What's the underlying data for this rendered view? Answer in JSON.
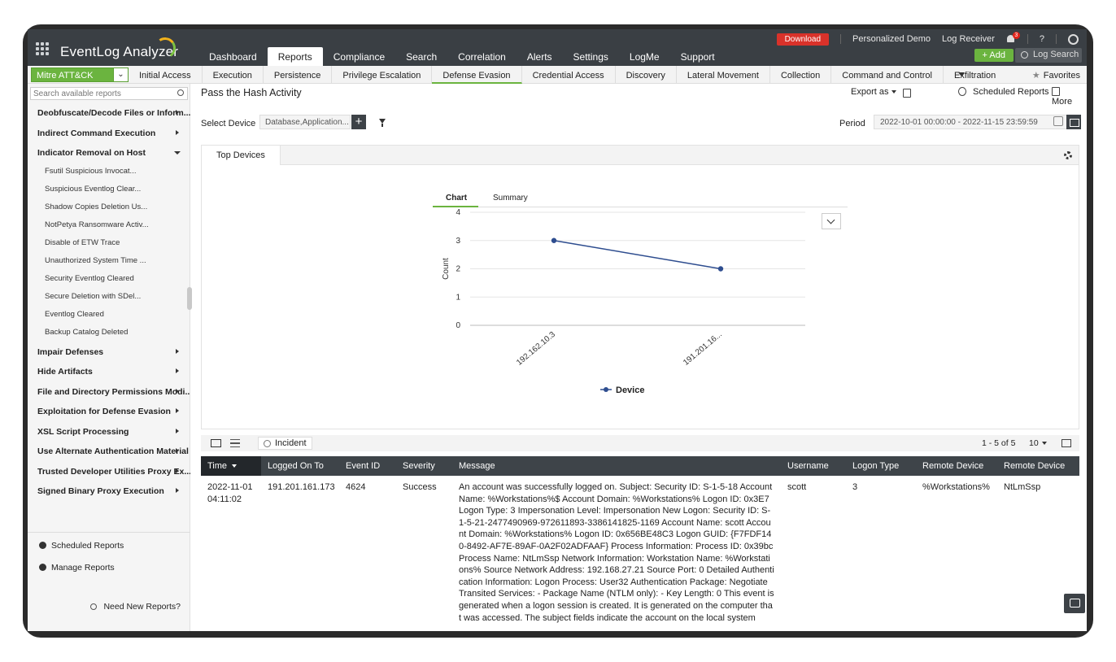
{
  "app": {
    "name": "EventLog Analyzer"
  },
  "main_nav": [
    "Dashboard",
    "Reports",
    "Compliance",
    "Search",
    "Correlation",
    "Alerts",
    "Settings",
    "LogMe",
    "Support"
  ],
  "main_nav_active": "Reports",
  "top_right": {
    "download": "Download",
    "personalized_demo": "Personalized Demo",
    "log_receiver": "Log Receiver",
    "notification_count": "3",
    "help": "?",
    "add": "+ Add",
    "log_search": "Log Search"
  },
  "sub_nav": {
    "framework": "Mitre ATT&CK",
    "tabs": [
      "Initial Access",
      "Execution",
      "Persistence",
      "Privilege Escalation",
      "Defense Evasion",
      "Credential Access",
      "Discovery",
      "Lateral Movement",
      "Collection",
      "Command and Control",
      "Exfiltration"
    ],
    "active": "Defense Evasion",
    "favorites": "Favorites"
  },
  "sidebar": {
    "search_placeholder": "Search available reports",
    "items_top": [
      {
        "label": "Deobfuscate/Decode Files or Inform...",
        "expanded": false
      },
      {
        "label": "Indirect Command Execution",
        "expanded": false
      },
      {
        "label": "Indicator Removal on Host",
        "expanded": true
      }
    ],
    "sub_items": [
      "Fsutil Suspicious Invocat...",
      "Suspicious Eventlog Clear...",
      "Shadow Copies Deletion Us...",
      "NotPetya Ransomware Activ...",
      "Disable of ETW Trace",
      "Unauthorized System Time ...",
      "Security Eventlog Cleared",
      "Secure Deletion with SDel...",
      "Eventlog Cleared",
      "Backup Catalog Deleted"
    ],
    "items_bottom": [
      "Impair Defenses",
      "Hide Artifacts",
      "File and Directory Permissions Modi...",
      "Exploitation for Defense Evasion",
      "XSL Script Processing",
      "Use Alternate Authentication Material",
      "Trusted Developer Utilities Proxy Ex...",
      "Signed Binary Proxy Execution"
    ],
    "scheduled_reports": "Scheduled Reports",
    "manage_reports": "Manage Reports",
    "need_new_reports": "Need New Reports?"
  },
  "report": {
    "title": "Pass the Hash Activity",
    "export_as": "Export as",
    "scheduled_reports": "Scheduled Reports",
    "more": "More",
    "select_device_label": "Select Device",
    "select_device_value": "Database,Application...",
    "period_label": "Period",
    "period_value": "2022-10-01 00:00:00 - 2022-11-15 23:59:59",
    "panel_tab": "Top Devices",
    "chart_tabs": [
      "Chart",
      "Summary"
    ]
  },
  "chart_data": {
    "type": "line",
    "categories": [
      "192.162.10.3",
      "191.201.16..."
    ],
    "series": [
      {
        "name": "Device",
        "values": [
          3,
          2
        ]
      }
    ],
    "ylabel": "Count",
    "ylim": [
      0,
      4
    ],
    "yticks": [
      0,
      1,
      2,
      3,
      4
    ],
    "legend_position": "bottom",
    "color": "#2e4d8f"
  },
  "table": {
    "incident": "Incident",
    "pager": "1 - 5 of 5",
    "per_page": "10",
    "columns": [
      "Time",
      "Logged On To",
      "Event ID",
      "Severity",
      "Message",
      "Username",
      "Logon Type",
      "Remote Device",
      "Remote Device"
    ],
    "rows": [
      {
        "time": "2022-11-01 04:11:02",
        "time_date": "2022-11-01",
        "time_clock": "04:11:02",
        "logged_on_to": "191.201.161.173",
        "event_id": "4624",
        "severity": "Success",
        "message": "An account was successfully logged on. Subject: Security ID: S-1-5-18 Account Name: %Workstations%$ Account Domain: %Workstations% Logon ID: 0x3E7 Logon Type: 3 Impersonation Level: Impersonation New Logon: Security ID: S-1-5-21-2477490969-972611893-3386141825-1169 Account Name: scott Account Domain: %Workstations% Logon ID: 0x656BE48C3 Logon GUID: {F7FDF140-8492-AF7E-89AF-0A2F02ADFAAF} Process Information: Process ID: 0x39bc Process Name: NtLmSsp Network Information: Workstation Name: %Workstations% Source Network Address: 192.168.27.21 Source Port: 0 Detailed Authentication Information: Logon Process: User32 Authentication Package: Negotiate Transited Services: - Package Name (NTLM only): - Key Length: 0 This event is generated when a logon session is created. It is generated on the computer that was accessed. The subject fields indicate the account on the local system",
        "username": "scott",
        "logon_type": "3",
        "remote_device_1": "%Workstations%",
        "remote_device_2": "NtLmSsp"
      }
    ]
  }
}
